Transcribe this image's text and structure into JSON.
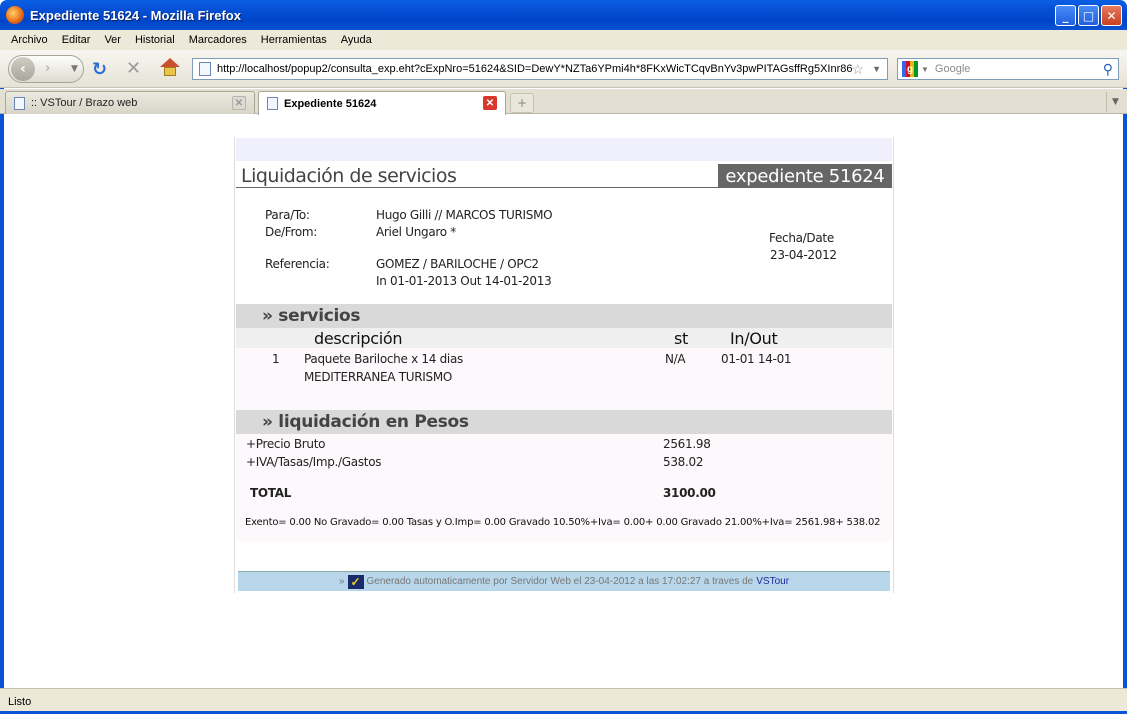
{
  "window": {
    "title": "Expediente 51624 - Mozilla Firefox",
    "buttons": {
      "minimize": "_",
      "maximize": "□",
      "close": "✕"
    }
  },
  "menu": [
    "Archivo",
    "Editar",
    "Ver",
    "Historial",
    "Marcadores",
    "Herramientas",
    "Ayuda"
  ],
  "toolbar": {
    "url": "http://localhost/popup2/consulta_exp.eht?cExpNro=51624&SID=DewY*NZTa6YPmi4h*8FKxWicTCqvBnYv3pwPITAGsffRg5XInr86",
    "search_placeholder": "Google"
  },
  "tabs": [
    {
      "label": ":: VSTour / Brazo web",
      "active": false
    },
    {
      "label": "Expediente 51624",
      "active": true
    }
  ],
  "doc": {
    "heading": "Liquidación de servicios",
    "expediente": "expediente 51624",
    "para_label": "Para/To:",
    "para_value": "Hugo Gilli // MARCOS TURISMO",
    "de_label": "De/From:",
    "de_value": "Ariel Ungaro *",
    "ref_label": "Referencia:",
    "ref_value": "GOMEZ / BARILOCHE / OPC2",
    "ref_dates": "In 01-01-2013 Out 14-01-2013",
    "fecha_label": "Fecha/Date",
    "fecha_value": "23-04-2012",
    "servicios_title": "» servicios",
    "col_desc": "descripción",
    "col_st": "st",
    "col_inout": "In/Out",
    "service": {
      "num": "1",
      "desc1": "Paquete Bariloche x 14 dias",
      "desc2": "MEDITERRANEA TURISMO",
      "st": "N/A",
      "inout": "01-01 14-01"
    },
    "liquidacion_title": "» liquidación en Pesos",
    "precio_label": "+Precio Bruto",
    "precio_value": "2561.98",
    "iva_label": "+IVA/Tasas/Imp./Gastos",
    "iva_value": "538.02",
    "total_label": "TOTAL",
    "total_value": "3100.00",
    "note": "Exento= 0.00 No Gravado= 0.00 Tasas y O.Imp= 0.00 Gravado 10.50%+Iva= 0.00+ 0.00 Gravado 21.00%+Iva= 2561.98+ 538.02",
    "generated_prefix": "»",
    "generated_text": "Generado automaticamente por Servidor Web el 23-04-2012 a las 17:02:27 a traves de",
    "generated_link": "VSTour"
  },
  "status": "Listo"
}
